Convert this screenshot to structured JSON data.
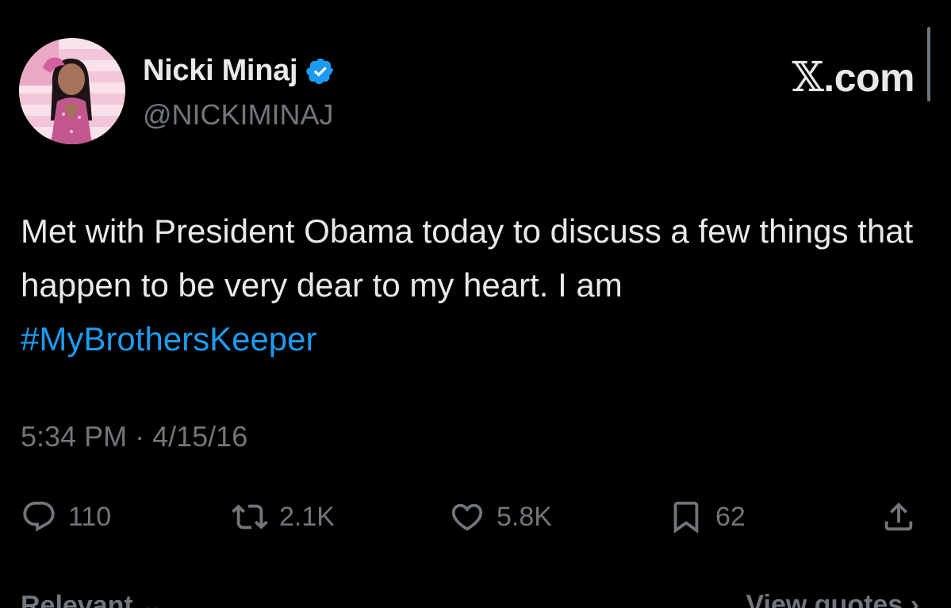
{
  "header": {
    "display_name": "Nicki Minaj",
    "handle": "@NICKIMINAJ",
    "brand_x": "𝕏",
    "brand_domain": ".com",
    "verified": true
  },
  "tweet": {
    "text_before": "Met with President Obama today to discuss a few things that happen to be very dear to my heart. I am ",
    "hashtag": "#MyBrothersKeeper",
    "time": "5:34 PM",
    "separator": "·",
    "date": "4/15/16"
  },
  "actions": {
    "replies": "110",
    "reposts": "2.1K",
    "likes": "5.8K",
    "bookmarks": "62"
  },
  "bottom": {
    "sort_label": "Relevant ⌄",
    "view_quotes_label": "View quotes ›"
  },
  "colors": {
    "background": "#000000",
    "primary_text": "#e7e9ea",
    "secondary_text": "#71767b",
    "accent": "#1d9bf0"
  },
  "icons": [
    "avatar-image",
    "verified-badge-icon",
    "reply-icon",
    "repost-icon",
    "like-icon",
    "bookmark-icon",
    "share-icon"
  ]
}
